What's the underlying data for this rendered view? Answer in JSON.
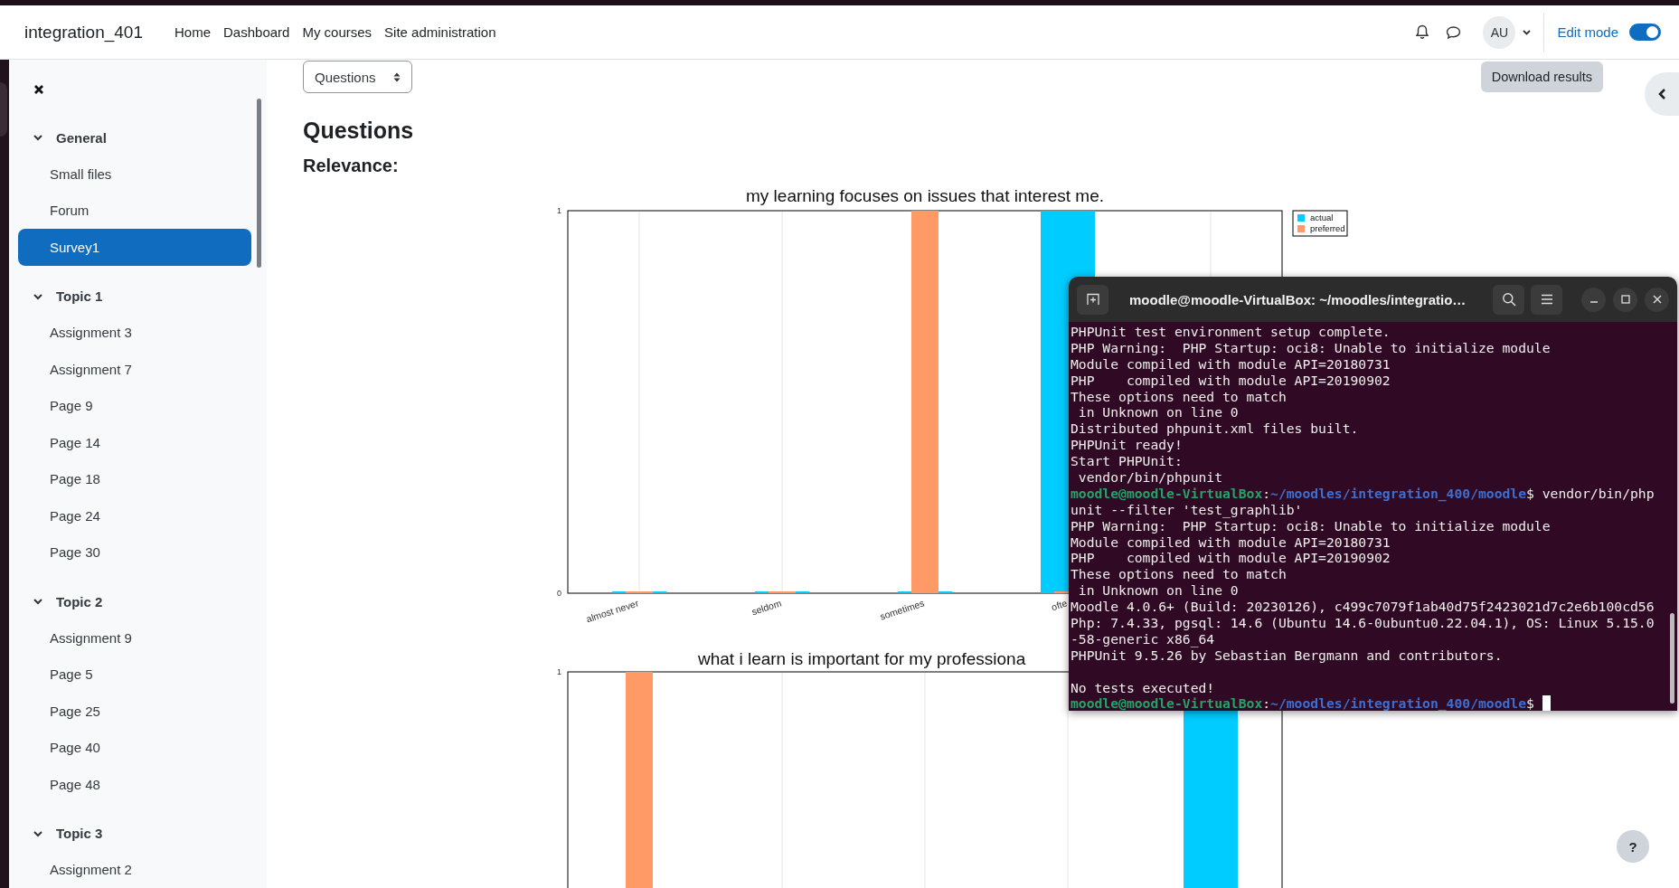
{
  "navbar": {
    "brand": "integration_401",
    "links": [
      "Home",
      "Dashboard",
      "My courses",
      "Site administration"
    ],
    "avatar": "AU",
    "edit_mode": {
      "label": "Edit mode",
      "on": true
    }
  },
  "sidebar": {
    "sections": [
      {
        "title": "General",
        "expanded": true,
        "items": [
          {
            "label": "Small files",
            "selected": false
          },
          {
            "label": "Forum",
            "selected": false
          },
          {
            "label": "Survey1",
            "selected": true
          }
        ]
      },
      {
        "title": "Topic 1",
        "expanded": true,
        "items": [
          {
            "label": "Assignment 3",
            "selected": false
          },
          {
            "label": "Assignment 7",
            "selected": false
          },
          {
            "label": "Page 9",
            "selected": false
          },
          {
            "label": "Page 14",
            "selected": false
          },
          {
            "label": "Page 18",
            "selected": false
          },
          {
            "label": "Page 24",
            "selected": false
          },
          {
            "label": "Page 30",
            "selected": false
          }
        ]
      },
      {
        "title": "Topic 2",
        "expanded": true,
        "items": [
          {
            "label": "Assignment 9",
            "selected": false
          },
          {
            "label": "Page 5",
            "selected": false
          },
          {
            "label": "Page 25",
            "selected": false
          },
          {
            "label": "Page 40",
            "selected": false
          },
          {
            "label": "Page 48",
            "selected": false
          }
        ]
      },
      {
        "title": "Topic 3",
        "expanded": true,
        "items": [
          {
            "label": "Assignment 2",
            "selected": false
          }
        ]
      }
    ]
  },
  "content": {
    "select": {
      "value": "Questions"
    },
    "download_button": "Download results",
    "heading": "Questions",
    "subheading": "Relevance:",
    "chart": {
      "chart_data": {
        "type": "bar",
        "title": "my learning focuses on issues that interest me.",
        "categories": [
          "almost never",
          "seldom",
          "sometimes",
          "ofte",
          null
        ],
        "ylim": [
          0,
          1
        ],
        "yticks": [
          0,
          1
        ],
        "legend": true,
        "series": [
          {
            "name": "actual",
            "color": "#00ccff",
            "values": [
              0,
              0,
              0,
              1,
              null
            ]
          },
          {
            "name": "preferred",
            "color": "#ff9966",
            "values": [
              0,
              0,
              1,
              0,
              null
            ]
          }
        ]
      }
    },
    "chart_picture": {
      "title": "what i learn is important for my professiona",
      "y_tick_label": "1"
    }
  },
  "terminal": {
    "title": "moodle@moodle-VirtualBox: ~/moodles/integratio…",
    "lines": [
      {
        "kind": "output",
        "text": "PHPUnit test environment setup complete."
      },
      {
        "kind": "output",
        "text": "PHP Warning:  PHP Startup: oci8: Unable to initialize module"
      },
      {
        "kind": "output",
        "text": "Module compiled with module API=20180731"
      },
      {
        "kind": "output",
        "text": "PHP    compiled with module API=20190902"
      },
      {
        "kind": "output",
        "text": "These options need to match"
      },
      {
        "kind": "output",
        "text": " in Unknown on line 0"
      },
      {
        "kind": "output",
        "text": "Distributed phpunit.xml files built."
      },
      {
        "kind": "output",
        "text": "PHPUnit ready!"
      },
      {
        "kind": "output",
        "text": "Start PHPUnit:"
      },
      {
        "kind": "output",
        "text": " vendor/bin/phpunit"
      },
      {
        "kind": "prompt",
        "user_host": "moodle@moodle-VirtualBox",
        "separator": ":",
        "path": "~/moodles/integration_400/moodle",
        "command": "$ vendor/bin/php"
      },
      {
        "kind": "output",
        "text": "unit --filter 'test_graphlib'"
      },
      {
        "kind": "output",
        "text": "PHP Warning:  PHP Startup: oci8: Unable to initialize module"
      },
      {
        "kind": "output",
        "text": "Module compiled with module API=20180731"
      },
      {
        "kind": "output",
        "text": "PHP    compiled with module API=20190902"
      },
      {
        "kind": "output",
        "text": "These options need to match"
      },
      {
        "kind": "output",
        "text": " in Unknown on line 0"
      },
      {
        "kind": "output",
        "text": "Moodle 4.0.6+ (Build: 20230126), c499c7079f1ab40d75f2423021d7c2e6b100cd56"
      },
      {
        "kind": "output",
        "text": "Php: 7.4.33, pgsql: 14.6 (Ubuntu 14.6-0ubuntu0.22.04.1), OS: Linux 5.15.0"
      },
      {
        "kind": "output",
        "text": "-58-generic x86_64"
      },
      {
        "kind": "output",
        "text": "PHPUnit 9.5.26 by Sebastian Bergmann and contributors."
      },
      {
        "kind": "blank"
      },
      {
        "kind": "output",
        "text": "No tests executed!"
      },
      {
        "kind": "prompt",
        "user_host": "moodle@moodle-VirtualBox",
        "separator": ":",
        "path": "~/moodles/integration_400/moodle",
        "command": "$"
      }
    ]
  },
  "help_button": "?"
}
